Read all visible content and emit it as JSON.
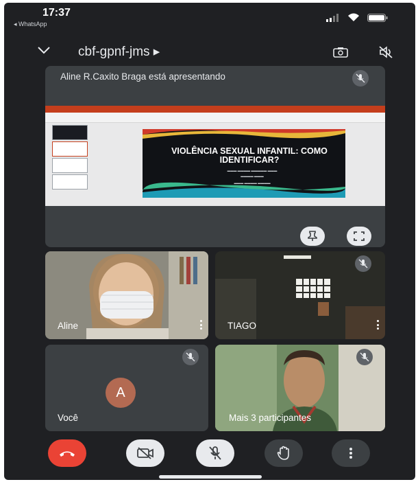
{
  "status_bar": {
    "time": "17:37",
    "back_app": "◂ WhatsApp"
  },
  "header": {
    "meeting_code": "cbf-gpnf-jms ▸"
  },
  "presentation": {
    "label": "Aline R.Caxito Braga está apresentando",
    "slide_title": "VIOLÊNCIA SEXUAL INFANTIL: COMO IDENTIFICAR?"
  },
  "tiles": [
    {
      "name": "Aline"
    },
    {
      "name": "TIAGO"
    },
    {
      "name": "Você",
      "avatar_letter": "A"
    },
    {
      "name": "Mais 3 participantes"
    }
  ],
  "controls": [
    "end-call",
    "camera-off",
    "mic-off",
    "raise-hand",
    "more-options"
  ],
  "colors": {
    "background": "#1f2023",
    "tile": "#3c4043",
    "end_call": "#ea4335",
    "avatar": "#b36a52"
  }
}
